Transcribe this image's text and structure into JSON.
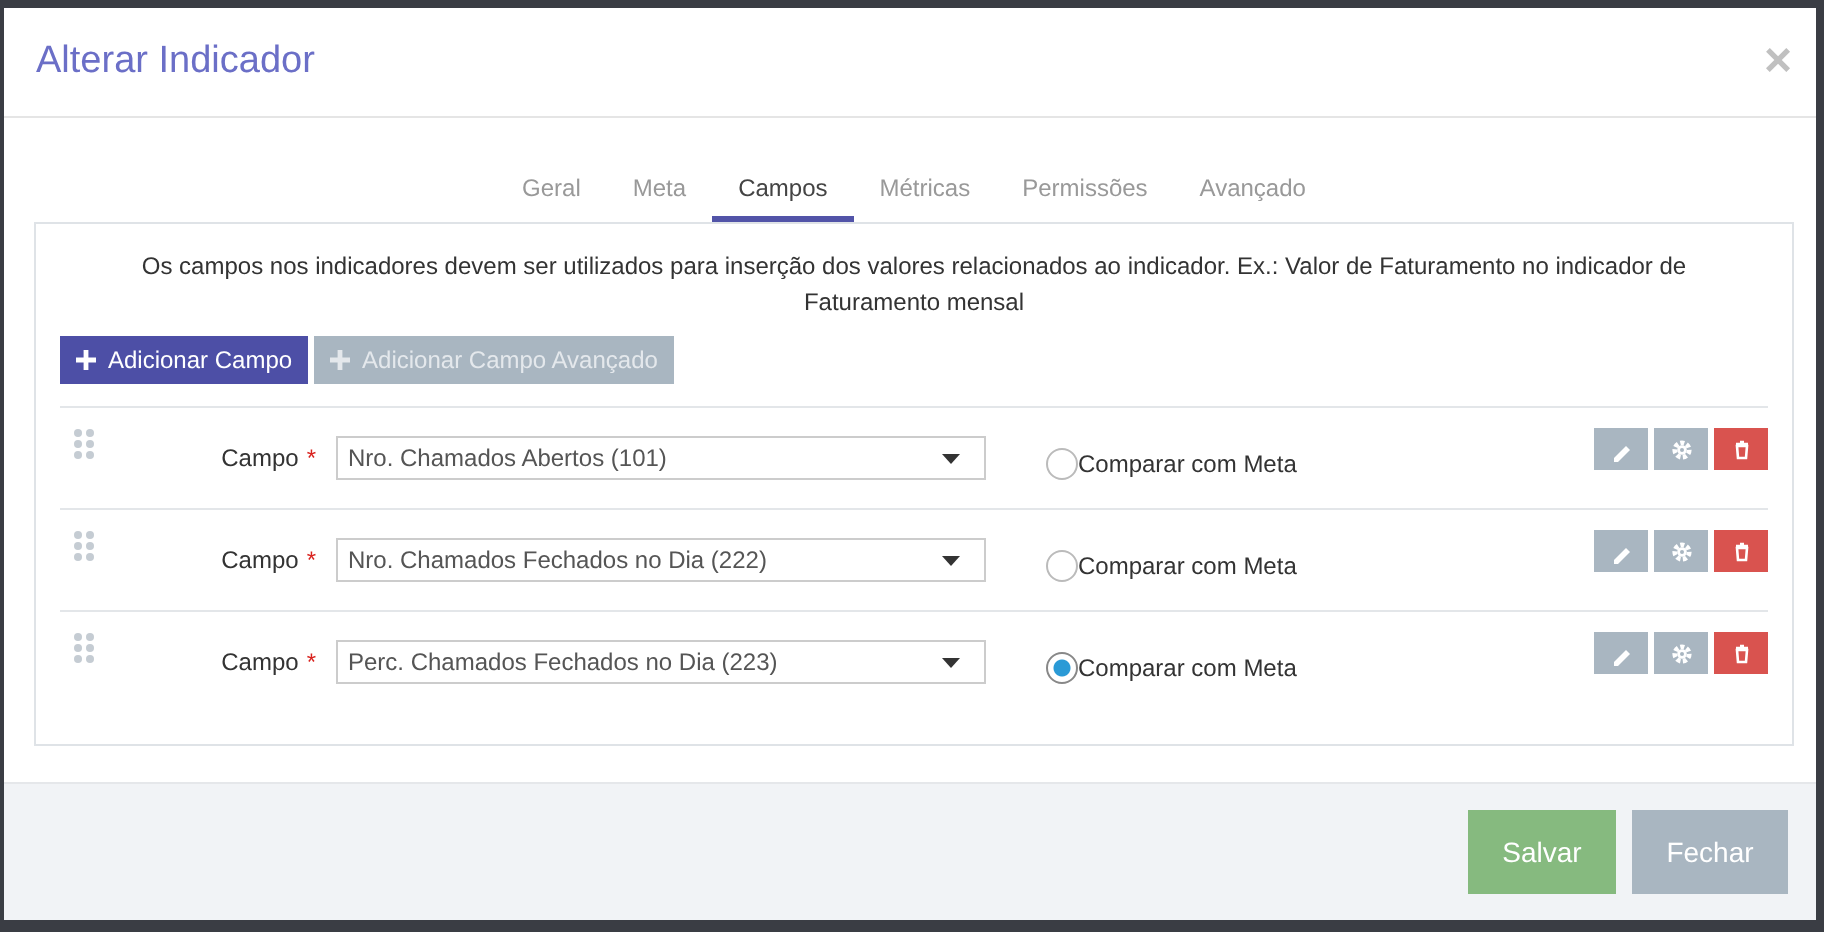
{
  "window": {
    "title": "Alterar Indicador",
    "close": "×"
  },
  "tabs": [
    {
      "label": "Geral",
      "selected": false
    },
    {
      "label": "Meta",
      "selected": false
    },
    {
      "label": "Campos",
      "selected": true
    },
    {
      "label": "Métricas",
      "selected": false
    },
    {
      "label": "Permissões",
      "selected": false
    },
    {
      "label": "Avançado",
      "selected": false
    }
  ],
  "description": "Os campos nos indicadores devem ser utilizados para inserção dos valores relacionados ao indicador. Ex.: Valor de Faturamento no indicador de Faturamento mensal",
  "add_buttons": [
    {
      "label": "Adicionar Campo",
      "disabled": false
    },
    {
      "label": "Adicionar Campo Avançado",
      "disabled": true
    }
  ],
  "fields": [
    {
      "label": "Campo",
      "required_mark": "*",
      "value": "Nro. Chamados Abertos (101)",
      "compare_label": "Comparar com Meta",
      "selected": false
    },
    {
      "label": "Campo",
      "required_mark": "*",
      "value": "Nro. Chamados Fechados no Dia (222)",
      "compare_label": "Comparar com Meta",
      "selected": false
    },
    {
      "label": "Campo",
      "required_mark": "*",
      "value": "Perc. Chamados Fechados no Dia (223)",
      "compare_label": "Comparar com Meta",
      "selected": true
    }
  ],
  "footer_buttons": [
    {
      "label": "Salvar",
      "kind": "primary"
    },
    {
      "label": "Fechar",
      "kind": "secondary"
    }
  ]
}
